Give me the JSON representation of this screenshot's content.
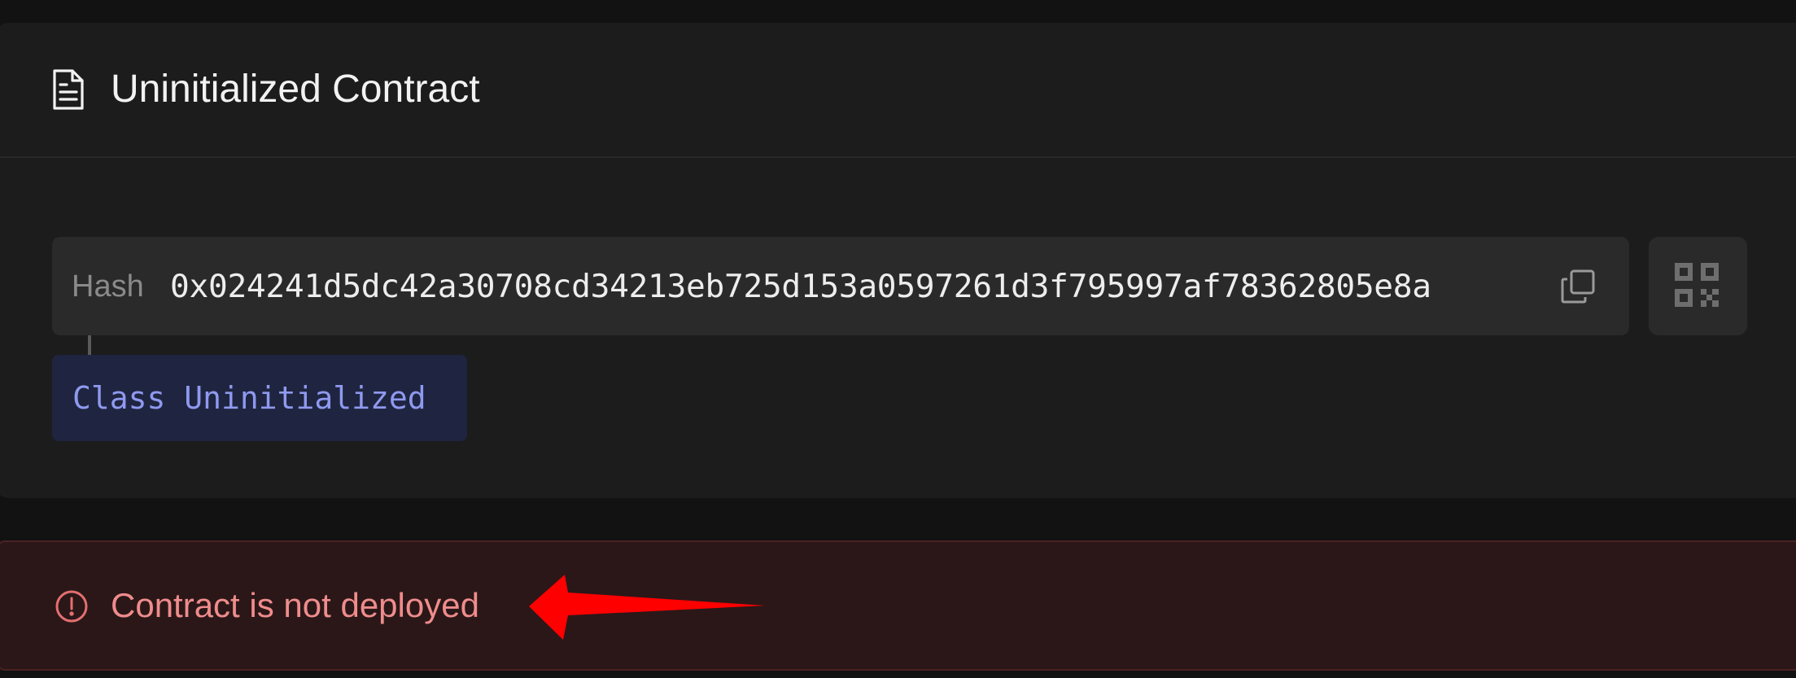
{
  "card": {
    "title": "Uninitialized Contract",
    "icon": "document-icon"
  },
  "hash": {
    "label": "Hash",
    "value": "0x024241d5dc42a30708cd34213eb725d153a0597261d3f795997af78362805e8a",
    "copy_icon": "copy-icon",
    "qr_icon": "qr-code-icon"
  },
  "class_badge": {
    "label": "Class Uninitialized"
  },
  "error": {
    "message": "Contract is not deployed",
    "icon": "alert-circle-icon"
  },
  "colors": {
    "background": "#121212",
    "card": "#1c1c1c",
    "field": "#2a2a2a",
    "badge_bg": "#1f2540",
    "badge_text": "#8f99ef",
    "error_bg": "#2b1718",
    "error_text": "#ef8c8c",
    "annotation_arrow": "#ff0000"
  }
}
